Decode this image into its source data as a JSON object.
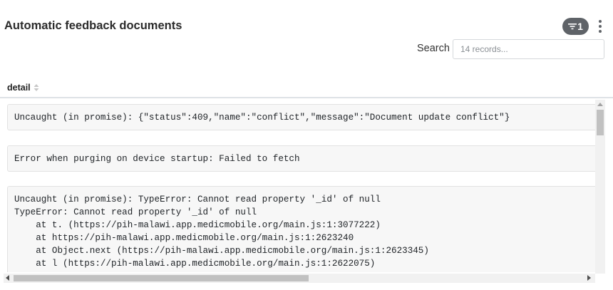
{
  "header": {
    "title": "Automatic feedback documents",
    "filter_count": "1",
    "filter_icon": "filter-icon",
    "menu_icon": "kebab-menu-icon"
  },
  "search": {
    "label": "Search",
    "placeholder": "14 records...",
    "value": ""
  },
  "table": {
    "column": "detail",
    "sort_icon": "sort-icon",
    "rows": [
      "Uncaught (in promise): {\"status\":409,\"name\":\"conflict\",\"message\":\"Document update conflict\"}",
      "Error when purging on device startup: Failed to fetch",
      "Uncaught (in promise): TypeError: Cannot read property '_id' of null\nTypeError: Cannot read property '_id' of null\n    at t. (https://pih-malawi.app.medicmobile.org/main.js:1:3077222)\n    at https://pih-malawi.app.medicmobile.org/main.js:1:2623240\n    at Object.next (https://pih-malawi.app.medicmobile.org/main.js:1:2623345)\n    at l (https://pih-malawi.app.medicmobile.org/main.js:1:2622075)"
    ]
  },
  "colors": {
    "badge_bg": "#5f6368",
    "cell_bg": "#f7f7f7",
    "cell_border": "#e2e2e2"
  }
}
